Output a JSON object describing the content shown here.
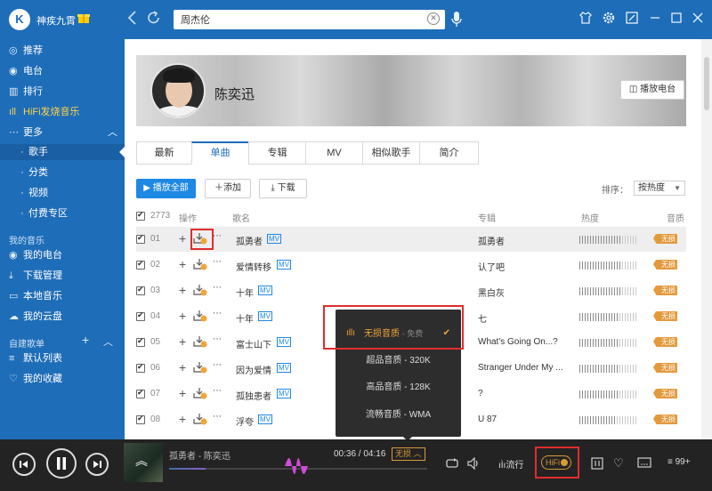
{
  "app": {
    "name": "神疾九霄",
    "logo_text": "K"
  },
  "search": {
    "value": "周杰伦",
    "clear_icon": "close-icon"
  },
  "toolbar_icons": [
    "shirt-icon",
    "gear-icon",
    "minimize-window-icon",
    "collapse-icon",
    "restore-icon",
    "close-icon"
  ],
  "sidebar": {
    "items": [
      {
        "icon": "recommend-icon",
        "label": "推荐"
      },
      {
        "icon": "radio-icon",
        "label": "电台"
      },
      {
        "icon": "chart-icon",
        "label": "排行"
      },
      {
        "icon": "hifi-wave-icon",
        "label": "HiFi发烧音乐"
      },
      {
        "icon": "more-dots-icon",
        "label": "更多"
      }
    ],
    "sub_items": [
      {
        "label": "歌手"
      },
      {
        "label": "分类"
      },
      {
        "label": "视频"
      },
      {
        "label": "付费专区"
      }
    ],
    "my_music_heading": "我的音乐",
    "my_music": [
      {
        "icon": "radio-icon",
        "label": "我的电台"
      },
      {
        "icon": "download-icon",
        "label": "下载管理"
      },
      {
        "icon": "computer-icon",
        "label": "本地音乐"
      },
      {
        "icon": "cloud-icon",
        "label": "我的云盘"
      }
    ],
    "playlists_heading": "自建歌单",
    "playlists": [
      {
        "icon": "playlist-icon",
        "label": "默认列表"
      },
      {
        "icon": "heart-icon",
        "label": "我的收藏"
      }
    ]
  },
  "artist": {
    "name": "陈奕迅",
    "radio_button": "播放电台"
  },
  "tabs": [
    "最新",
    "单曲",
    "专辑",
    "MV",
    "相似歌手",
    "简介"
  ],
  "active_tab": "单曲",
  "actions": {
    "play_all": "▶ 播放全部",
    "add": "添加",
    "download": "下载"
  },
  "sort": {
    "label": "排序：",
    "value": "按热度"
  },
  "table": {
    "headers": {
      "count": "2773",
      "ops": "操作",
      "song": "歌名",
      "album": "专辑",
      "heat": "热度",
      "quality": "音质"
    },
    "rows": [
      {
        "num": "01",
        "title": "孤勇者",
        "mv": "MV",
        "album": "孤勇者",
        "quality": "无损",
        "heat": 0.72
      },
      {
        "num": "02",
        "title": "爱情转移",
        "mv": "MV",
        "album": "认了吧",
        "quality": "无损",
        "heat": 0.7
      },
      {
        "num": "03",
        "title": "十年",
        "mv": "MV",
        "album": "黑白灰",
        "quality": "无损",
        "heat": 0.7
      },
      {
        "num": "04",
        "title": "十年",
        "mv": "MV",
        "album": "七",
        "quality": "无损",
        "heat": 0.68
      },
      {
        "num": "05",
        "title": "富士山下",
        "mv": "MV",
        "album": "What's Going On...?",
        "quality": "无损",
        "heat": 0.68
      },
      {
        "num": "06",
        "title": "因为爱情",
        "mv": "MV",
        "album": "Stranger Under My ...",
        "quality": "无损",
        "heat": 0.66
      },
      {
        "num": "07",
        "title": "孤独患者",
        "mv": "MV",
        "album": "?",
        "quality": "无损",
        "heat": 0.66
      },
      {
        "num": "08",
        "title": "浮夸",
        "mv": "MV",
        "album": "U 87",
        "quality": "无损",
        "heat": 0.64
      }
    ]
  },
  "quality_popup": {
    "options": [
      {
        "label": "无损音质",
        "note": "- 免费",
        "selected": true
      },
      {
        "label": "超品音质 - 320K"
      },
      {
        "label": "高品音质 - 128K"
      },
      {
        "label": "流畅音质 - WMA"
      }
    ]
  },
  "player": {
    "now_playing": "孤勇者 - 陈奕迅",
    "time": "00:36 / 04:16",
    "quality": "无损",
    "progress": 0.14,
    "mode": "流行",
    "hifi": "HiFi",
    "queue_count": "99+"
  },
  "colors": {
    "brand": "#1e6db8",
    "accent_orange": "#e39a3c",
    "highlight_red": "#e12c2c",
    "player_bg": "#232323"
  }
}
